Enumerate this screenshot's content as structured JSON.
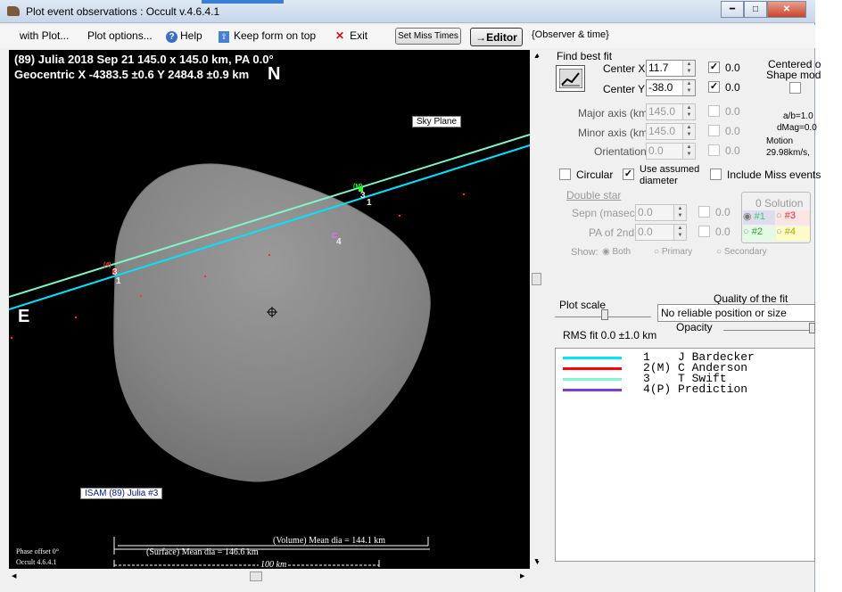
{
  "window": {
    "title": "Plot event observations : Occult v.4.6.4.1"
  },
  "menu": {
    "with_plot": "with Plot...",
    "plot_options": "Plot options...",
    "help": "Help",
    "keep_on_top": "Keep form on top",
    "exit": "Exit",
    "set_miss_times": "Set Miss Times",
    "editor": "→Editor",
    "observer_time": "{Observer & time}"
  },
  "plot": {
    "header1": "(89) Julia  2018 Sep 21   145.0 x 145.0 km, PA 0.0°",
    "header2": "Geocentric  X  -4383.5 ±0.6  Y 2484.8 ±0.9 km",
    "north": "N",
    "east": "E",
    "sky_plane": "Sky Plane",
    "model_label": "ISAM (89) Julia  #3",
    "phase_offset": "Phase offset 0°",
    "version": "Occult 4.6.4.1",
    "volume_dia": "(Volume) Mean dia = 144.1 km",
    "surface_dia": "(Surface) Mean dia = 146.6 km",
    "scale_bar": "100 km",
    "chord_labels": [
      "3",
      "1",
      "3",
      "1",
      "4",
      "(M)",
      "(4)"
    ]
  },
  "panel": {
    "find_best_fit": "Find best fit",
    "center_x_label": "Center X",
    "center_x": "11.7",
    "center_x_fit": "0.0",
    "center_y_label": "Center Y",
    "center_y": "-38.0",
    "center_y_fit": "0.0",
    "major_label": "Major axis (km)",
    "major": "145.0",
    "major_fit": "0.0",
    "minor_label": "Minor axis (km)",
    "minor": "145.0",
    "minor_fit": "0.0",
    "orient_label": "Orientation",
    "orient": "0.0",
    "orient_fit": "0.0",
    "centered_on": "Centered o",
    "shape_model": "Shape mod",
    "ab_ratio": "a/b=1.0",
    "dmag": "dMag=0.0",
    "motion_label": "Motion",
    "motion_value": "29.98km/s,",
    "circular": "Circular",
    "use_assumed": "Use assumed",
    "diameter": "diameter",
    "include_miss": "Include Miss events",
    "double_star": "Double star",
    "sepn_label": "Sepn (masec)",
    "sepn": "0.0",
    "sepn_fit": "0.0",
    "pa2_label": "PA of 2nd",
    "pa2": "0.0",
    "pa2_fit": "0.0",
    "solution_title": "0 Solution",
    "sol1": "#1",
    "sol2": "#2",
    "sol3": "#3",
    "sol4": "#4",
    "show_label": "Show:",
    "show_both": "Both",
    "show_primary": "Primary",
    "show_secondary": "Secondary",
    "plot_scale": "Plot scale",
    "quality_label": "Quality of the fit",
    "quality_value": "No reliable position or size",
    "opacity_label": "Opacity",
    "rms_fit": "RMS fit  0.0 ±1.0 km"
  },
  "legend": [
    {
      "num": "1",
      "flag": "   ",
      "name": "J Bardecker",
      "color": "#00e5ff"
    },
    {
      "num": "2",
      "flag": "(M)",
      "name": "C Anderson",
      "color": "#ff0000"
    },
    {
      "num": "3",
      "flag": "   ",
      "name": "T Swift",
      "color": "#7ff5c8"
    },
    {
      "num": "4",
      "flag": "(P)",
      "name": "Prediction",
      "color": "#7a3fdc"
    }
  ],
  "colors": {
    "chord1": "#00e5ff",
    "chord3": "#7ff5c8",
    "miss": "#ff0000",
    "prediction": "#7a3fdc"
  }
}
